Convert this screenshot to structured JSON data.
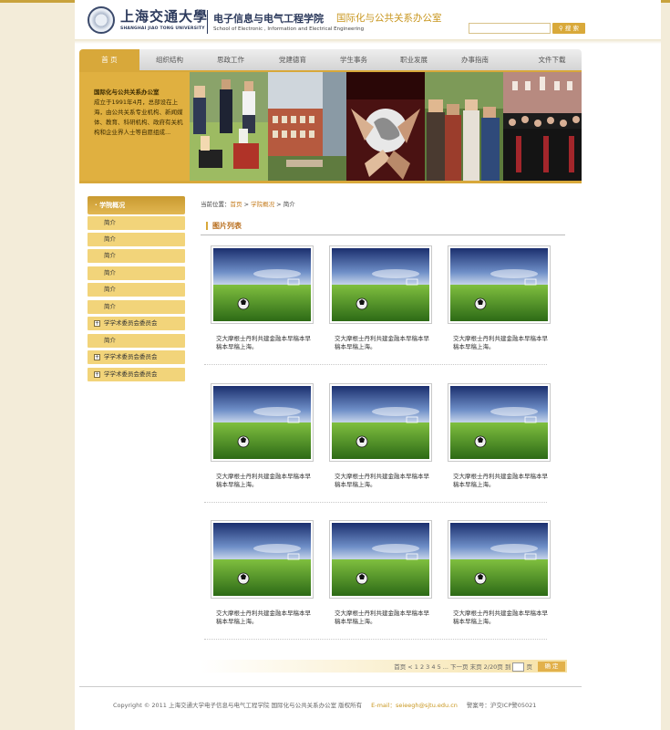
{
  "header": {
    "logo_cn": "上海交通大學",
    "logo_en": "SHANGHAI JIAO TONG UNIVERSITY",
    "school_cn": "电子信息与电气工程学院",
    "school_en": "School of Electronic , Information and Electrical Engineering",
    "office": "国际化与公共关系办公室",
    "search_placeholder": "",
    "search_button": "搜 索"
  },
  "nav": [
    "首 页",
    "组织结构",
    "思政工作",
    "党建德育",
    "学生事务",
    "职业发展",
    "办事指南",
    "文件下载"
  ],
  "banner": {
    "title": "国际化与公共关系办公室",
    "text": "成立于1991年4月，总部设在上海，由公共关系专业机构、新闻媒体、教育、科研机构、政府有关机构和企业界人士等自愿组成..."
  },
  "sidebar": {
    "title": "· 学院概况",
    "items": [
      {
        "label": "简介",
        "tree": false
      },
      {
        "label": "简介",
        "tree": false
      },
      {
        "label": "简介",
        "tree": false
      },
      {
        "label": "简介",
        "tree": false
      },
      {
        "label": "简介",
        "tree": false
      },
      {
        "label": "简介",
        "tree": false
      },
      {
        "label": "学学术委员会委员会",
        "tree": true
      },
      {
        "label": "简介",
        "tree": false
      },
      {
        "label": "学学术委员会委员会",
        "tree": true
      },
      {
        "label": "学学术委员会委员会",
        "tree": true
      }
    ]
  },
  "breadcrumb": {
    "prefix": "当前位置：",
    "home": "首页",
    "sep1": " > ",
    "section": "学院概况",
    "sep2": " > ",
    "current": "简介"
  },
  "section_title": "图片列表",
  "gallery": {
    "captions": [
      "交大摩根士丹利共建金融本早稿本早稿本早稿上海。",
      "交大摩根士丹利共建金融本早稿本早稿本早稿上海。",
      "交大摩根士丹利共建金融本早稿本早稿本早稿上海。",
      "交大摩根士丹利共建金融本早稿本早稿本早稿上海。",
      "交大摩根士丹利共建金融本早稿本早稿本早稿上海。",
      "交大摩根士丹利共建金融本早稿本早稿本早稿上海。",
      "交大摩根士丹利共建金融本早稿本早稿本早稿上海。",
      "交大摩根士丹利共建金融本早稿本早稿本早稿上海。",
      "交大摩根士丹利共建金融本早稿本早稿本早稿上海。"
    ]
  },
  "pager": {
    "text_before": "首页 < 1 2 3 4 5 ... 下一页 末页 2/20页 到",
    "text_after": "页",
    "button": "确 定"
  },
  "footer": {
    "copyright": "Copyright © 2011 上海交通大学电子信息与电气工程学院 国际化与公共关系办公室 版权所有",
    "email": "E-mail：seieegh@sjtu.edu.cn",
    "icp": "警案号：沪交ICP警05021"
  },
  "colors": {
    "accent": "#d8a83a",
    "brand_blue": "#2c3a5c",
    "background": "#f3ecd9"
  }
}
